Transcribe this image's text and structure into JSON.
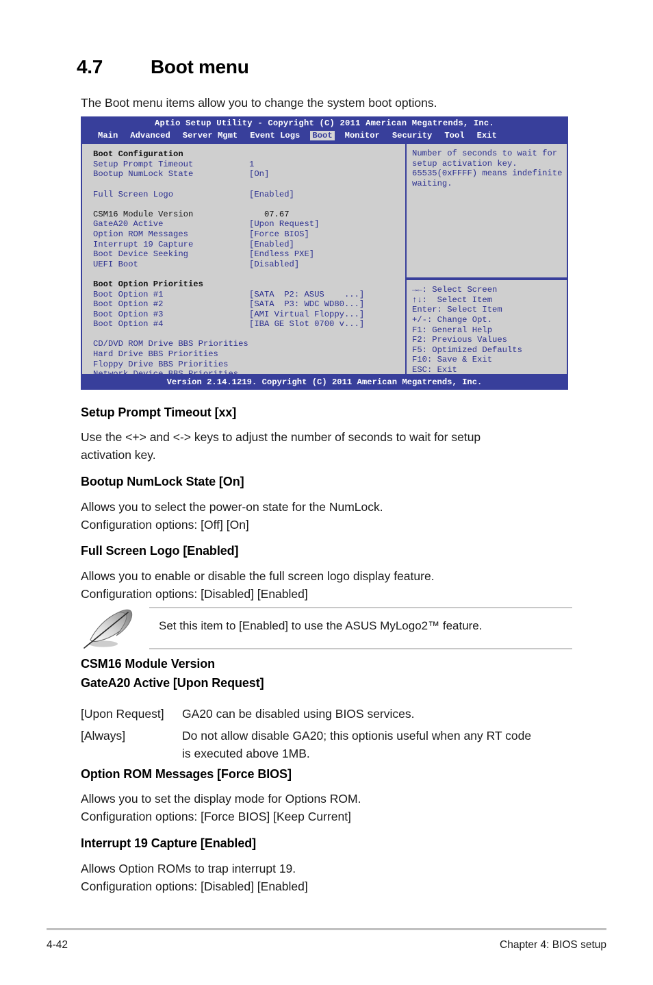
{
  "section": {
    "number": "4.7",
    "title": "Boot menu",
    "intro": "The Boot menu items allow you to change the system boot options."
  },
  "bios": {
    "title": "Aptio Setup Utility - Copyright (C) 2011 American Megatrends, Inc.",
    "menu": [
      {
        "label": "Main",
        "active": false
      },
      {
        "label": "Advanced",
        "active": false
      },
      {
        "label": "Server Mgmt",
        "active": false
      },
      {
        "label": "Event Logs",
        "active": false
      },
      {
        "label": "Boot",
        "active": true
      },
      {
        "label": "Monitor",
        "active": false
      },
      {
        "label": "Security",
        "active": false
      },
      {
        "label": "Tool",
        "active": false
      },
      {
        "label": "Exit",
        "active": false
      }
    ],
    "group1_header": "Boot Configuration",
    "items1": [
      {
        "label": "Setup Prompt Timeout",
        "value": "1"
      },
      {
        "label": "Bootup NumLock State",
        "value": "[On]"
      }
    ],
    "items2": [
      {
        "label": "Full Screen Logo",
        "value": "[Enabled]"
      }
    ],
    "csm_label": "CSM16 Module Version",
    "csm_value": "07.67",
    "items3": [
      {
        "label": "GateA20 Active",
        "value": "[Upon Request]"
      },
      {
        "label": "Option ROM Messages",
        "value": "[Force BIOS]"
      },
      {
        "label": "Interrupt 19 Capture",
        "value": "[Enabled]"
      },
      {
        "label": "Boot Device Seeking",
        "value": "[Endless PXE]"
      },
      {
        "label": "UEFI Boot",
        "value": "[Disabled]"
      }
    ],
    "group2_header": "Boot Option Priorities",
    "boot_options": [
      {
        "label": "Boot Option #1",
        "value": "[SATA  P2: ASUS    ...]"
      },
      {
        "label": "Boot Option #2",
        "value": "[SATA  P3: WDC WD80...]"
      },
      {
        "label": "Boot Option #3",
        "value": "[AMI Virtual Floppy...]"
      },
      {
        "label": "Boot Option #4",
        "value": "[IBA GE Slot 0700 v...]"
      }
    ],
    "bbs_links": [
      "CD/DVD ROM Drive BBS Priorities",
      "Hard Drive BBS Priorities",
      "Floppy Drive BBS Priorities",
      "Network Device BBS Priorities"
    ],
    "help_lines": [
      "Number of seconds to wait for",
      "setup activation key.",
      "65535(0xFFFF) means indefinite",
      "waiting."
    ],
    "key_lines": [
      "→←: Select Screen",
      "↑↓:  Select Item",
      "Enter: Select Item",
      "+/-: Change Opt.",
      "F1: General Help",
      "F2: Previous Values",
      "F5: Optimized Defaults",
      "F10: Save & Exit",
      "ESC: Exit"
    ],
    "footer": "Version 2.14.1219. Copyright (C) 2011 American Megatrends, Inc."
  },
  "topics": {
    "setup_prompt_timeout": {
      "heading": "Setup Prompt Timeout [xx]",
      "lines": [
        "Use the <+> and <-> keys to adjust the number of seconds to wait for setup",
        "activation key."
      ]
    },
    "bootup_numlock": {
      "heading": "Bootup NumLock State [On]",
      "lines": [
        "Allows you to select the power-on state for the NumLock.",
        "Configuration options: [Off] [On]"
      ]
    },
    "full_screen_logo": {
      "heading": "Full Screen Logo [Enabled]",
      "lines": [
        "Allows you to enable or disable the full screen logo display feature.",
        "Configuration options: [Disabled] [Enabled]"
      ]
    },
    "note": {
      "text": "Set this item to [Enabled] to use the ASUS MyLogo2™ feature."
    },
    "csm16": {
      "heading_line1": "CSM16 Module Version",
      "heading_line2": "GateA20 Active [Upon Request]",
      "def1_term": "[Upon Request]",
      "def1_desc": "GA20 can be disabled using BIOS services.",
      "def2_term": "[Always]",
      "def2_desc": "Do not allow disable GA20; this optionis useful when any RT code",
      "def2_desc_cont": "is executed above 1MB."
    },
    "option_rom": {
      "heading": "Option ROM Messages [Force BIOS]",
      "lines": [
        "Allows you to set the display mode for Options ROM.",
        "Configuration options: [Force BIOS] [Keep Current]"
      ]
    },
    "interrupt19": {
      "heading": "Interrupt 19 Capture [Enabled]",
      "lines": [
        "Allows Option ROMs to trap interrupt 19.",
        "Configuration options: [Disabled] [Enabled]"
      ]
    }
  },
  "page_footer": {
    "page_number": "4-42",
    "chapter": "Chapter 4: BIOS setup"
  },
  "colors": {
    "bios_blue": "#383f9b",
    "bios_text_blue": "#2b2f8f",
    "bios_bg": "#cfcfcf",
    "tab_active_bg": "#d5d5d5"
  }
}
